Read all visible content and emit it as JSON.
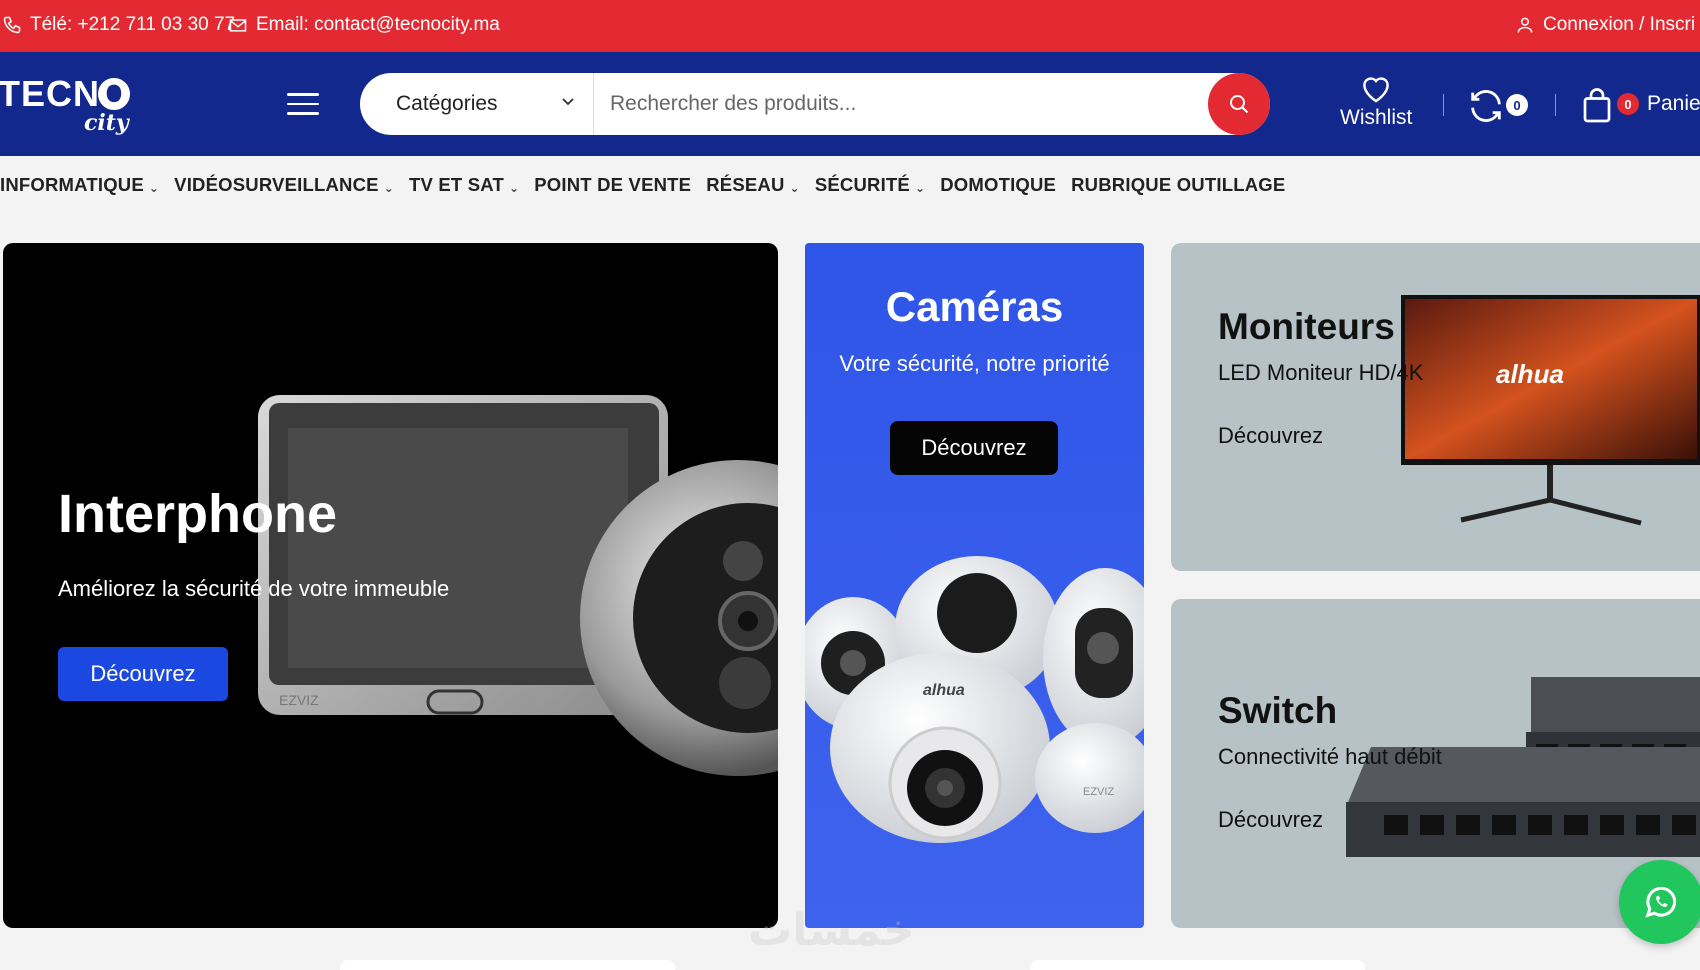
{
  "topbar": {
    "phone": "Télé: +212 711 03 30 77",
    "email": "Email: contact@tecnocity.ma",
    "account": "Connexion / Inscri"
  },
  "header": {
    "logo_main": "TECNO",
    "logo_sub": "city",
    "categories_label": "Catégories",
    "search_placeholder": "Rechercher des produits...",
    "wishlist_label": "Wishlist",
    "compare_count": "0",
    "cart_count": "0",
    "cart_label": "Panie"
  },
  "nav": {
    "items": [
      {
        "label": "INFORMATIQUE",
        "dropdown": "⌄"
      },
      {
        "label": "VIDÉOSURVEILLANCE",
        "dropdown": "⌄"
      },
      {
        "label": "TV ET SAT",
        "dropdown": "⌄"
      },
      {
        "label": "POINT DE VENTE",
        "dropdown": ""
      },
      {
        "label": "RÉSEAU",
        "dropdown": "⌄"
      },
      {
        "label": "SÉCURITÉ",
        "dropdown": "⌄"
      },
      {
        "label": "DOMOTIQUE",
        "dropdown": ""
      },
      {
        "label": "RUBRIQUE OUTILLAGE",
        "dropdown": ""
      }
    ]
  },
  "banners": {
    "interphone": {
      "title": "Interphone",
      "subtitle": "Améliorez la sécurité de votre immeuble",
      "cta": "Découvrez",
      "brand": "EZVIZ"
    },
    "cameras": {
      "title": "Caméras",
      "subtitle": "Votre sécurité, notre priorité",
      "cta": "Découvrez",
      "brand1": "alhua",
      "brand2": "EZVIZ"
    },
    "moniteurs": {
      "title": "Moniteurs",
      "subtitle": "LED Moniteur HD/4K",
      "cta": "Découvrez",
      "brand": "alhua"
    },
    "switch": {
      "title": "Switch",
      "subtitle": "Connectivité haut débit",
      "cta": "Découvrez"
    }
  },
  "watermark": "خمسات",
  "colors": {
    "topbar": "#e32a33",
    "header": "#12288c",
    "accent_blue": "#1a48e0",
    "whatsapp": "#21c65d"
  }
}
